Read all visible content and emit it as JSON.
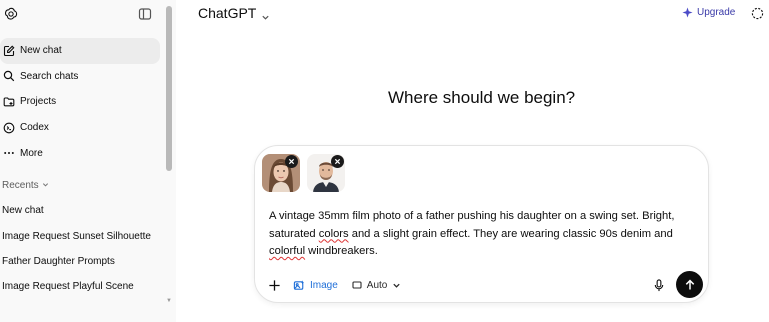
{
  "sidebar": {
    "nav": [
      {
        "label": "New chat",
        "icon": "edit-icon",
        "active": true
      },
      {
        "label": "Search chats",
        "icon": "search-icon"
      },
      {
        "label": "Projects",
        "icon": "folder-icon"
      },
      {
        "label": "Codex",
        "icon": "codex-icon"
      },
      {
        "label": "More",
        "icon": "more-icon"
      }
    ],
    "recents_label": "Recents",
    "recents": [
      "New chat",
      "Image Request Sunset Silhouette",
      "Father Daughter Prompts",
      "Image Request Playful Scene"
    ]
  },
  "header": {
    "title": "ChatGPT",
    "upgrade_label": "Upgrade"
  },
  "main": {
    "headline": "Where should we begin?"
  },
  "composer": {
    "attachments": [
      {
        "name": "woman-portrait"
      },
      {
        "name": "man-portrait"
      }
    ],
    "prompt_parts": {
      "p1": "A vintage 35mm film photo of a father pushing his daughter on a swing set. Bright, saturated ",
      "p2": "colors",
      "p3": " and a slight grain effect. They are wearing classic 90s denim and ",
      "p4": "colorful",
      "p5": " windbreakers."
    },
    "image_tool_label": "Image",
    "auto_label": "Auto"
  },
  "colors": {
    "accent": "#1f6fd8",
    "upgrade": "#3a3aa8",
    "send_bg": "#0d0d0d",
    "sidebar_bg": "#f9f9f9"
  }
}
